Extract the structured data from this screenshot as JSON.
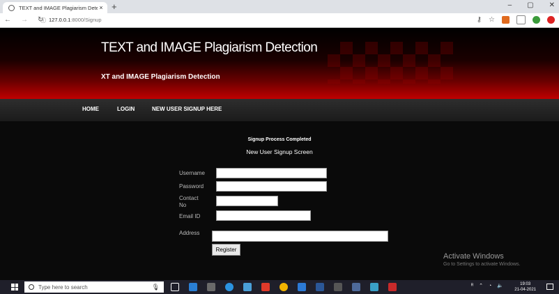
{
  "browser": {
    "tab_title": "TEXT and IMAGE Plagiarism Dete",
    "tab_close": "×",
    "new_tab": "+",
    "url_host": "127.0.0.1",
    "url_rest": ":8000/Signup",
    "win_min": "–",
    "win_max": "▢",
    "win_close": "✕"
  },
  "header": {
    "title": "TEXT and IMAGE Plagiarism Detection",
    "subtitle": "XT and IMAGE Plagiarism Detection"
  },
  "nav": {
    "items": [
      "HOME",
      "LOGIN",
      "NEW USER SIGNUP HERE"
    ]
  },
  "main": {
    "status": "Signup Process Completed",
    "form_title": "New User Signup Screen",
    "fields": {
      "username_label": "Username",
      "password_label": "Password",
      "contact_label": "Contact No",
      "email_label": "Email ID",
      "address_label": "Address"
    },
    "register_label": "Register"
  },
  "watermark": {
    "line1": "Activate Windows",
    "line2": "Go to Settings to activate Windows."
  },
  "taskbar": {
    "search_placeholder": "Type here to search",
    "time": "19:03",
    "date": "21-04-2021"
  },
  "colors": {
    "header_red": "#c00000",
    "nav_bg": "#222222",
    "page_bg": "#0a0a0a"
  }
}
